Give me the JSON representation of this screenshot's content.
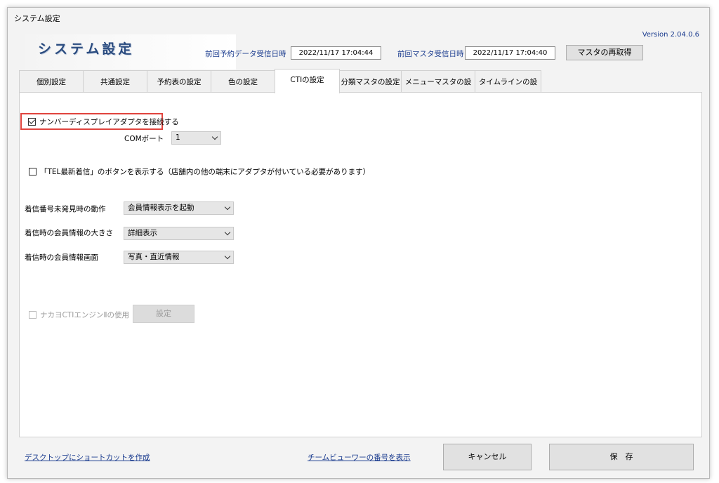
{
  "window": {
    "title": "システム設定"
  },
  "header": {
    "app_title": "システム設定",
    "version": "Version 2.04.0.6",
    "last_reservation_label": "前回予約データ受信日時",
    "last_reservation_value": "2022/11/17 17:04:44",
    "last_master_label": "前回マスタ受信日時",
    "last_master_value": "2022/11/17 17:04:40",
    "refetch_button": "マスタの再取得"
  },
  "tabs": [
    {
      "label": "個別設定"
    },
    {
      "label": "共通設定"
    },
    {
      "label": "予約表の設定"
    },
    {
      "label": "色の設定"
    },
    {
      "label": "CTIの設定",
      "active": true
    },
    {
      "label": "分類マスタの設定"
    },
    {
      "label": "メニューマスタの設定"
    },
    {
      "label": "タイムラインの設定"
    }
  ],
  "cti": {
    "connect_adapter_label": "ナンバーディスプレイアダプタを接続する",
    "connect_adapter_checked": true,
    "com_port_label": "COMポート",
    "com_port_value": "1",
    "tel_latest_label": "「TEL最新着信」のボタンを表示する（店舗内の他の端末にアダプタが付いている必要があります）",
    "tel_latest_checked": false,
    "unfound_action_label": "着信番号未発見時の動作",
    "unfound_action_value": "会員情報表示を起動",
    "member_info_size_label": "着信時の会員情報の大きさ",
    "member_info_size_value": "詳細表示",
    "member_info_screen_label": "着信時の会員情報画面",
    "member_info_screen_value": "写真・直近情報",
    "nakayo_label": "ナカヨCTIエンジンⅡの使用",
    "nakayo_checked": false,
    "nakayo_settings_button": "設定"
  },
  "footer": {
    "desktop_shortcut_link": "デスクトップにショートカットを作成",
    "team_viewer_link": "チームビューワーの番号を表示",
    "cancel_button": "キャンセル",
    "save_button": "保　存"
  },
  "colors": {
    "accent_red": "#e0443e",
    "label_blue": "#1b3c8f"
  }
}
